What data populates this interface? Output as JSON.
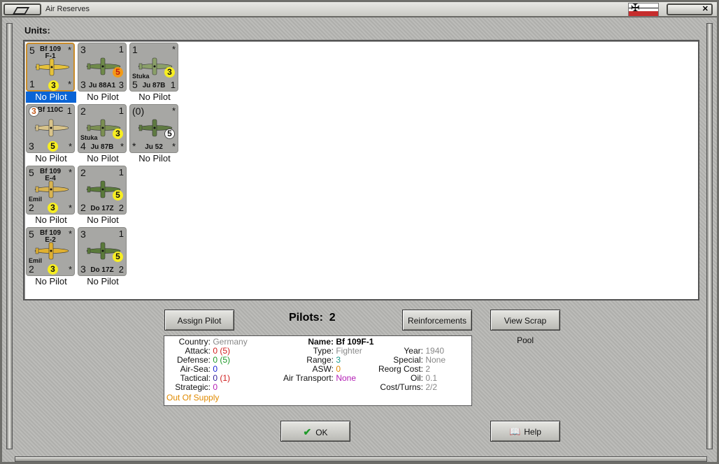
{
  "window": {
    "title": "Air Reserves"
  },
  "units_label": "Units:",
  "units": [
    {
      "tl": "5",
      "tr": "*",
      "name1": "Bf 109",
      "name2": "F-1",
      "range": "3",
      "bl": "1",
      "br": "*",
      "bottom": "",
      "nick": "",
      "pilot": "No Pilot",
      "selected": true
    },
    {
      "tl": "3",
      "tr": "1",
      "name1": "",
      "name2": "",
      "range": "5",
      "bl": "3",
      "br": "3",
      "bottom": "Ju 88A1",
      "nick": "",
      "pilot": "No Pilot",
      "selected": false
    },
    {
      "tl": "1",
      "tr": "*",
      "name1": "",
      "name2": "",
      "range": "3",
      "bl": "5",
      "br": "1",
      "bottom": "Ju 87B",
      "nick": "Stuka",
      "pilot": "No Pilot",
      "selected": false
    },
    {
      "tl": "3",
      "tr": "1",
      "name1": "Bf 110C",
      "name2": "",
      "range": "5",
      "bl": "3",
      "br": "*",
      "bottom": "",
      "nick": "",
      "pilot": "No Pilot",
      "selected": false
    },
    {
      "tl": "2",
      "tr": "1",
      "name1": "",
      "name2": "",
      "range": "3",
      "bl": "4",
      "br": "*",
      "bottom": "Ju 87B",
      "nick": "Stuka",
      "pilot": "No Pilot",
      "selected": false
    },
    {
      "tl": "(0)",
      "tr": "*",
      "name1": "",
      "name2": "",
      "range": "5",
      "bl": "*",
      "br": "*",
      "bottom": "Ju 52",
      "nick": "",
      "pilot": "No Pilot",
      "selected": false
    },
    {
      "tl": "5",
      "tr": "*",
      "name1": "Bf 109",
      "name2": "E-4",
      "range": "3",
      "bl": "2",
      "br": "*",
      "bottom": "",
      "nick": "Emil",
      "pilot": "No Pilot",
      "selected": false
    },
    {
      "tl": "2",
      "tr": "1",
      "name1": "",
      "name2": "",
      "range": "5",
      "bl": "2",
      "br": "2",
      "bottom": "Do 17Z",
      "nick": "",
      "pilot": "No Pilot",
      "selected": false
    },
    {
      "tl": "5",
      "tr": "*",
      "name1": "Bf 109",
      "name2": "E-2",
      "range": "3",
      "bl": "2",
      "br": "*",
      "bottom": "",
      "nick": "Emil",
      "pilot": "No Pilot",
      "selected": false
    },
    {
      "tl": "3",
      "tr": "1",
      "name1": "",
      "name2": "",
      "range": "5",
      "bl": "3",
      "br": "2",
      "bottom": "Do 17Z",
      "nick": "",
      "pilot": "No Pilot",
      "selected": false
    }
  ],
  "buttons": {
    "assign_pilot": "Assign Pilot",
    "reinforcements": "Reinforcements",
    "view_scrap_pool": "View Scrap Pool",
    "ok": "OK",
    "help": "Help"
  },
  "pilots": {
    "label": "Pilots:",
    "count": "2"
  },
  "info": {
    "country_label": "Country:",
    "country": "Germany",
    "attack_label": "Attack:",
    "attack": "0",
    "attack_extra": "(5)",
    "defense_label": "Defense:",
    "defense": "0",
    "defense_extra": "(5)",
    "airsea_label": "Air-Sea:",
    "airsea": "0",
    "tactical_label": "Tactical:",
    "tactical": "0",
    "tactical_extra": "(1)",
    "strategic_label": "Strategic:",
    "strategic": "0",
    "supply": "Out Of Supply",
    "name_label": "Name:",
    "name": "Bf 109F-1",
    "type_label": "Type:",
    "type": "Fighter",
    "range_label": "Range:",
    "range": "3",
    "asw_label": "ASW:",
    "asw": "0",
    "airtransport_label": "Air Transport:",
    "airtransport": "None",
    "year_label": "Year:",
    "year": "1940",
    "special_label": "Special:",
    "special": "None",
    "reorg_label": "Reorg Cost:",
    "reorg": "2",
    "oil_label": "Oil:",
    "oil": "0.1",
    "costturns_label": "Cost/Turns:",
    "costturns": "2/2"
  },
  "colors": {
    "selection": "#0a64d6",
    "range_badge": "#f7ee22"
  }
}
